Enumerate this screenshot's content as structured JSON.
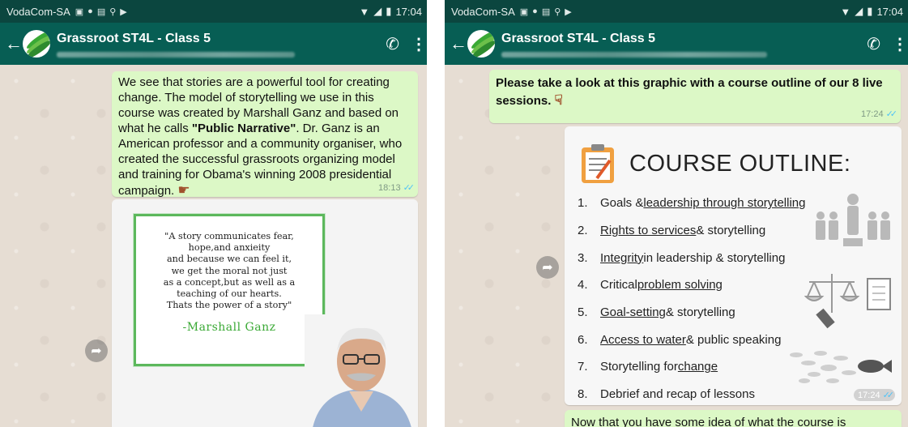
{
  "left": {
    "status": {
      "carrier": "VodaCom-SA",
      "time": "17:04"
    },
    "header": {
      "title": "Grassroot ST4L - Class 5"
    },
    "messages": {
      "story": {
        "pre": "We see that stories are a powerful tool for creating change. The model of storytelling we use in this course was created by Marshall Ganz and based on what he calls ",
        "bold": "\"Public Narrative\"",
        "post": ". Dr. Ganz is an American professor and a community organiser, who created the successful grassroots organizing model and training for Obama's winning 2008 presidential campaign.",
        "time": "18:13"
      },
      "quote": {
        "lines": [
          "\"A story communicates fear,",
          "hope,and anxieity",
          "and because we can feel it,",
          "we get the moral not just",
          "as a concept,but as well as a",
          "teaching of our hearts.",
          "Thats the power of a story\""
        ],
        "author": "-Marshall Ganz"
      }
    }
  },
  "right": {
    "status": {
      "carrier": "VodaCom-SA",
      "time": "17:04"
    },
    "header": {
      "title": "Grassroot ST4L - Class 5"
    },
    "messages": {
      "intro": {
        "text": "Please take a look at this graphic with a course outline of our 8 live sessions.",
        "time": "17:24"
      },
      "outline": {
        "title": "COURSE OUTLINE:",
        "items": [
          {
            "num": "1.",
            "pre": "Goals & ",
            "u": "leadership through storytelling",
            "post": ""
          },
          {
            "num": "2.",
            "pre": "",
            "u": "Rights to services ",
            "post": "& storytelling"
          },
          {
            "num": "3.",
            "pre": "",
            "u": "Integrity",
            "post": " in leadership & storytelling"
          },
          {
            "num": "4.",
            "pre": "Critical ",
            "u": "problem solving",
            "post": ""
          },
          {
            "num": "5.",
            "pre": "",
            "u": "Goal-setting",
            "post": " & storytelling"
          },
          {
            "num": "6.",
            "pre": "",
            "u": "Access to water",
            "post": " & public speaking"
          },
          {
            "num": "7.",
            "pre": "Storytelling for ",
            "u": "change",
            "post": ""
          },
          {
            "num": "8.",
            "pre": "Debrief and recap of lessons",
            "u": "",
            "post": ""
          }
        ],
        "time": "17:24"
      },
      "next": {
        "text": "Now that you have some idea of what the course is"
      }
    }
  },
  "icons": {
    "status": [
      "sim-icon",
      "android-icon",
      "message-icon",
      "usb-icon",
      "play-icon"
    ],
    "right_status": [
      "wifi-icon",
      "signal-icon",
      "battery-icon"
    ]
  },
  "colors": {
    "appbar": "#075e54",
    "statusbar": "#0b463f",
    "bubble": "#dcf8c6",
    "ticks": "#4fc3f7",
    "quote_border": "#5cb85c"
  }
}
